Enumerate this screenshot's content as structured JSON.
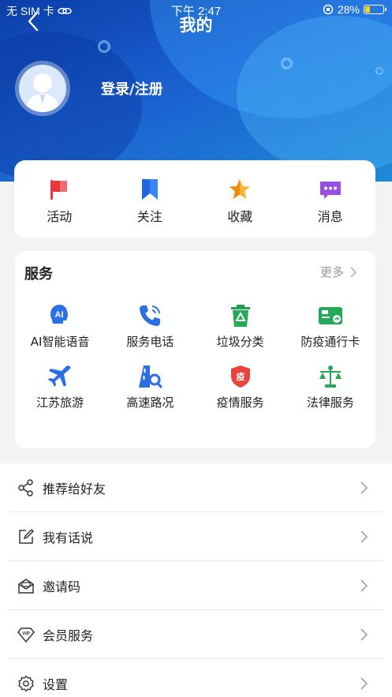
{
  "status_bar": {
    "carrier": "无 SIM 卡",
    "time": "下午 2:47",
    "battery_percent": "28%",
    "battery_level": 0.28
  },
  "header": {
    "title": "我的"
  },
  "profile": {
    "login_label": "登录/注册"
  },
  "quick_actions": [
    {
      "label": "活动",
      "icon": "flag-icon",
      "color": "#f0474c"
    },
    {
      "label": "关注",
      "icon": "bookmark-icon",
      "color": "#2a7cf0"
    },
    {
      "label": "收藏",
      "icon": "star-icon",
      "color": "#f7a21b"
    },
    {
      "label": "消息",
      "icon": "message-icon",
      "color": "#8b3fd6"
    }
  ],
  "services": {
    "title": "服务",
    "more_label": "更多",
    "items": [
      {
        "label": "AI智能语音",
        "icon": "ai-voice-icon",
        "color": "#2a6fe8"
      },
      {
        "label": "服务电话",
        "icon": "phone-icon",
        "color": "#2a6fe8"
      },
      {
        "label": "垃圾分类",
        "icon": "recycle-bin-icon",
        "color": "#20a050"
      },
      {
        "label": "防疫通行卡",
        "icon": "pass-card-icon",
        "color": "#20a050"
      },
      {
        "label": "江苏旅游",
        "icon": "airplane-icon",
        "color": "#2a6fe8"
      },
      {
        "label": "高速路况",
        "icon": "road-search-icon",
        "color": "#2a6fe8"
      },
      {
        "label": "疫情服务",
        "icon": "epidemic-shield-icon",
        "color": "#e8443c",
        "badge": "疫"
      },
      {
        "label": "法律服务",
        "icon": "scales-icon",
        "color": "#20a050"
      }
    ]
  },
  "menu": [
    {
      "label": "推荐给好友",
      "icon": "share-icon"
    },
    {
      "label": "我有话说",
      "icon": "edit-icon"
    },
    {
      "label": "邀请码",
      "icon": "mail-icon"
    },
    {
      "label": "会员服务",
      "icon": "vip-icon",
      "badge": "VIP"
    },
    {
      "label": "设置",
      "icon": "settings-icon"
    }
  ]
}
